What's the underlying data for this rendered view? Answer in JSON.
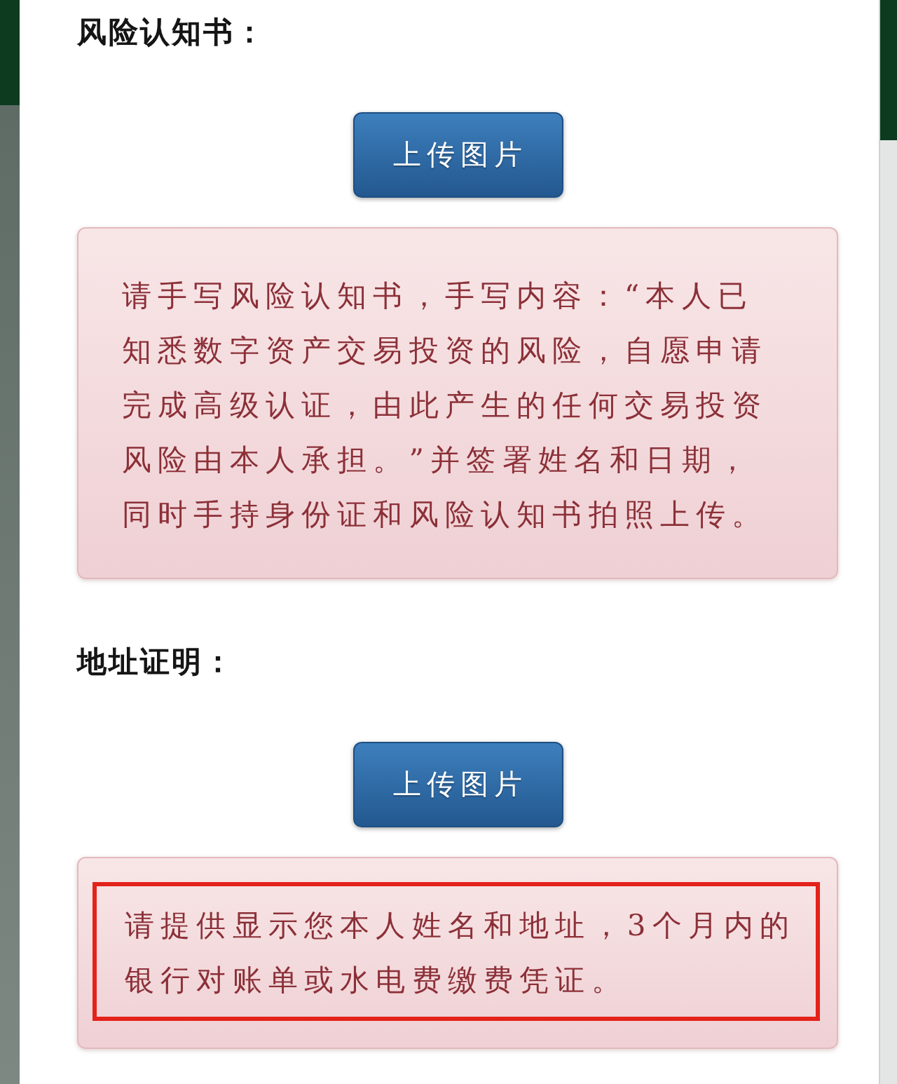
{
  "sections": [
    {
      "heading": "风险认知书：",
      "button": "上传图片",
      "note": "请手写风险认知书，手写内容：“本人已知悉数字资产交易投资的风险，自愿申请完成高级认证，由此产生的任何交易投资风险由本人承担。”并签署姓名和日期，同时手持身份证和风险认知书拍照上传。",
      "highlighted": false
    },
    {
      "heading": "地址证明：",
      "button": "上传图片",
      "note": "请提供显示您本人姓名和地址，3个月内的银行对账单或水电费缴费凭证。",
      "highlighted": true
    }
  ]
}
